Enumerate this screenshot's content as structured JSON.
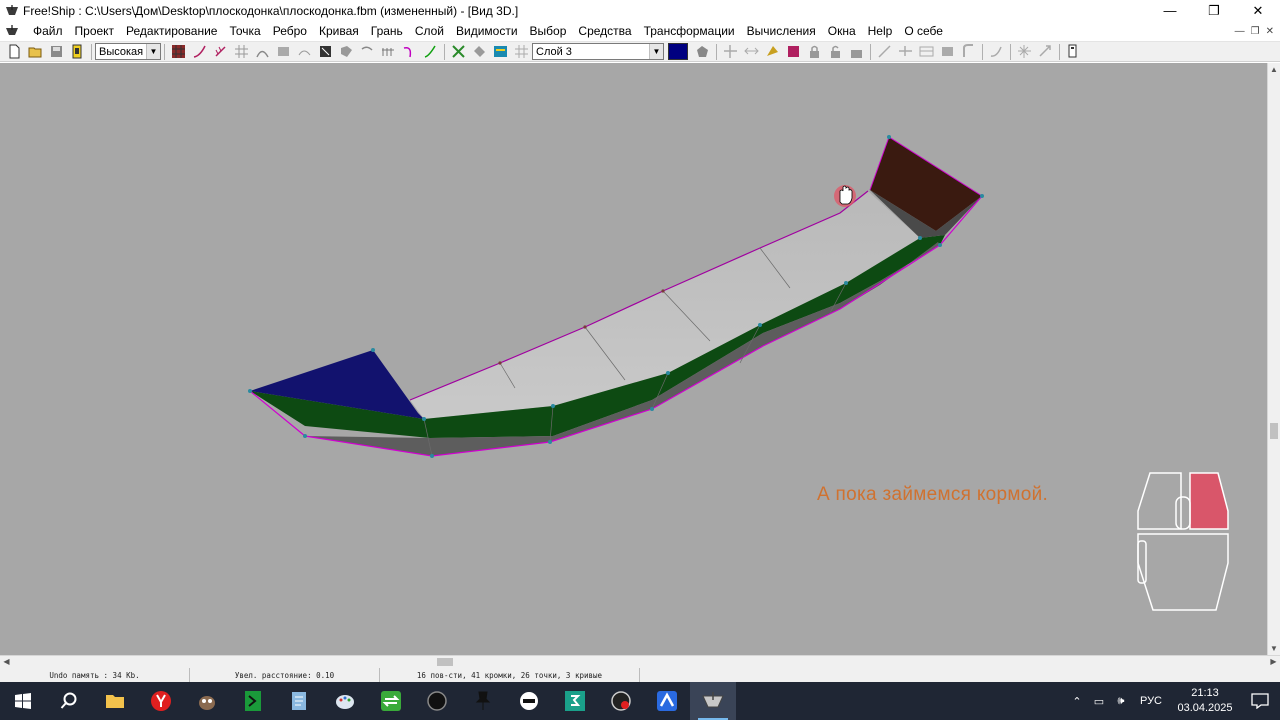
{
  "window": {
    "title": "Free!Ship  : C:\\Users\\Дом\\Desktop\\плоскодонка\\плоскодонка.fbm (измененный) - [Вид 3D.]",
    "minimize": "—",
    "maximize": "❐",
    "close": "✕"
  },
  "menu": {
    "items": [
      "Файл",
      "Проект",
      "Редактирование",
      "Точка",
      "Ребро",
      "Кривая",
      "Грань",
      "Слой",
      "Видимости",
      "Выбор",
      "Средства",
      "Трансформации",
      "Вычисления",
      "Окна",
      "Help",
      "О себе"
    ],
    "mdi_minimize": "—",
    "mdi_restore": "❐",
    "mdi_close": "✕"
  },
  "toolbar": {
    "precision_value": "Высокая",
    "layer_value": "Слой 3",
    "layer_color": "#000080"
  },
  "viewport": {
    "background": "#a7a7a7",
    "caption": "А пока займемся кормой."
  },
  "status": {
    "undo": "Undo память : 34 Kb.",
    "distance": "Увел. расстояние: 0.10",
    "counts": "16 пов-сти, 41 кромки, 26 точки, 3 кривые"
  },
  "taskbar": {
    "lang": "РУС",
    "time": "21:13",
    "date": "03.04.2025",
    "icons": [
      "start-icon",
      "search-icon",
      "file-explorer-icon",
      "yandex-browser-icon",
      "gimp-icon",
      "green-app-icon",
      "notepad-icon",
      "paint-icon",
      "sync-icon",
      "circle-app-icon",
      "pin-icon",
      "chat-icon",
      "3d-app-icon",
      "obs-icon",
      "arrow-app-icon",
      "freeship-icon"
    ]
  },
  "colors": {
    "caption": "#d07230",
    "stern_transom": "#3a1a10",
    "bow_transom": "#12126e",
    "hull_side": "#0d4a12",
    "deck": "#bfbfbf",
    "control_line": "#c800c8"
  }
}
